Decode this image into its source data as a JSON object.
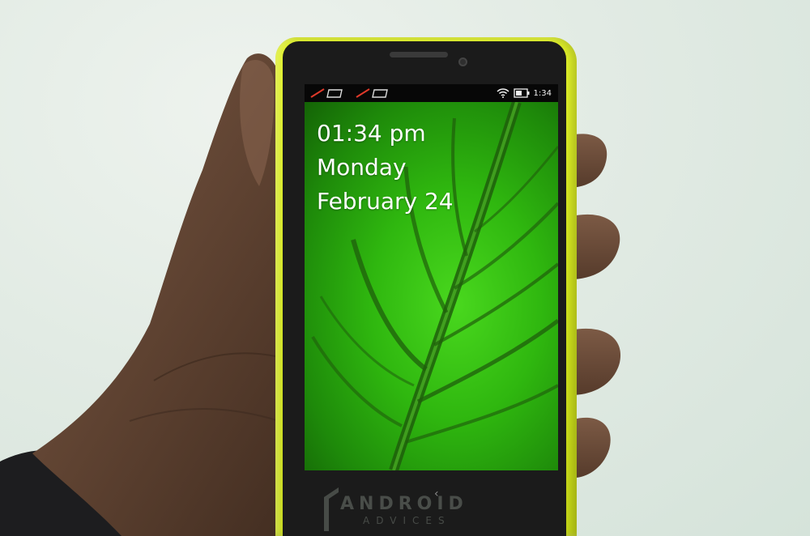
{
  "lock_screen": {
    "time": "01:34 pm",
    "day": "Monday",
    "date": "February 24"
  },
  "status_bar": {
    "time": "1:34",
    "icons": [
      "missed-call-icon",
      "message-icon",
      "missed-call-icon",
      "message-icon",
      "wifi-icon",
      "battery-icon"
    ]
  },
  "navigation": {
    "back_glyph": "‹"
  },
  "watermark": {
    "line1": "ANDROID",
    "line2": "ADVICES"
  },
  "colors": {
    "phone_body": "#d6e822",
    "screen_wallpaper": "#2fb70f",
    "missed_call_red": "#e0392a"
  }
}
